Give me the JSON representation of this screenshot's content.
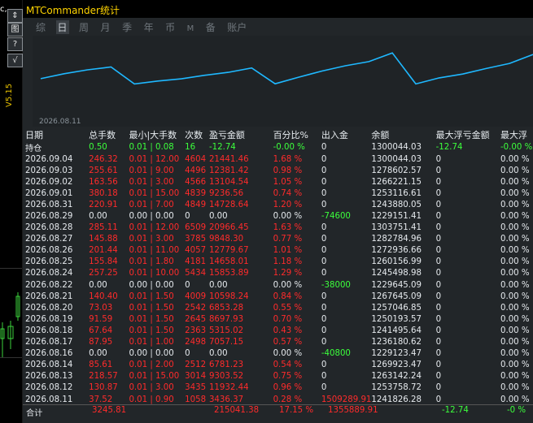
{
  "left_strip": {
    "top_text": "c,",
    "btn1": "⇕",
    "btn2": "图",
    "btn3": "?",
    "btn4": "√",
    "version": "V5.15"
  },
  "window": {
    "title": "MTCommander统计"
  },
  "tabs": [
    "综",
    "日",
    "周",
    "月",
    "季",
    "年",
    "币",
    "M",
    "备",
    "账户"
  ],
  "active_tab": "日",
  "chart": {
    "date_label": "2026.08.11",
    "line_color": "#1fb8ff",
    "chart_data": {
      "type": "line",
      "x_label": "",
      "y_label": "",
      "series": [
        {
          "values": [
            1241826,
            1245498,
            1250193,
            1257046,
            1260156,
            1272936,
            1282784,
            1303751,
            1303751,
            1300044
          ]
        }
      ]
    }
  },
  "headers": [
    "日期",
    "总手数",
    "最小|大手数",
    "次数",
    "盈亏金额",
    "百分比%",
    "出入金",
    "余额",
    "最大浮亏金额",
    "最大浮"
  ],
  "holding": [
    "持仓",
    "0.50",
    "0.01 | 0.08",
    "16",
    "-12.74",
    "-0.00 %",
    "0",
    "1300044.03",
    "-12.74",
    "-0.00 %"
  ],
  "rows": [
    [
      "2026.09.04",
      "246.32",
      "0.01 | 12.00",
      "4604",
      "21441.46",
      "1.68 %",
      "0",
      "1300044.03",
      "0",
      "0.00 %"
    ],
    [
      "2026.09.03",
      "255.61",
      "0.01 | 9.00",
      "4496",
      "12381.42",
      "0.98 %",
      "0",
      "1278602.57",
      "0",
      "0.00 %"
    ],
    [
      "2026.09.02",
      "163.56",
      "0.01 | 3.00",
      "4566",
      "13104.54",
      "1.05 %",
      "0",
      "1266221.15",
      "0",
      "0.00 %"
    ],
    [
      "2026.09.01",
      "380.18",
      "0.01 | 15.00",
      "4839",
      "9236.56",
      "0.74 %",
      "0",
      "1253116.61",
      "0",
      "0.00 %"
    ],
    [
      "2026.08.31",
      "220.91",
      "0.01 | 7.00",
      "4849",
      "14728.64",
      "1.20 %",
      "0",
      "1243880.05",
      "0",
      "0.00 %"
    ],
    [
      "2026.08.29",
      "0.00",
      "0.00 | 0.00",
      "0",
      "0.00",
      "0.00 %",
      "-74600",
      "1229151.41",
      "0",
      "0.00 %"
    ],
    [
      "2026.08.28",
      "285.11",
      "0.01 | 12.00",
      "6509",
      "20966.45",
      "1.63 %",
      "0",
      "1303751.41",
      "0",
      "0.00 %"
    ],
    [
      "2026.08.27",
      "145.88",
      "0.01 | 3.00",
      "3785",
      "9848.30",
      "0.77 %",
      "0",
      "1282784.96",
      "0",
      "0.00 %"
    ],
    [
      "2026.08.26",
      "201.44",
      "0.01 | 11.00",
      "4057",
      "12779.67",
      "1.01 %",
      "0",
      "1272936.66",
      "0",
      "0.00 %"
    ],
    [
      "2026.08.25",
      "155.84",
      "0.01 | 1.80",
      "4181",
      "14658.01",
      "1.18 %",
      "0",
      "1260156.99",
      "0",
      "0.00 %"
    ],
    [
      "2026.08.24",
      "257.25",
      "0.01 | 10.00",
      "5434",
      "15853.89",
      "1.29 %",
      "0",
      "1245498.98",
      "0",
      "0.00 %"
    ],
    [
      "2026.08.22",
      "0.00",
      "0.00 | 0.00",
      "0",
      "0.00",
      "0.00 %",
      "-38000",
      "1229645.09",
      "0",
      "0.00 %"
    ],
    [
      "2026.08.21",
      "140.40",
      "0.01 | 1.50",
      "4009",
      "10598.24",
      "0.84 %",
      "0",
      "1267645.09",
      "0",
      "0.00 %"
    ],
    [
      "2026.08.20",
      "73.03",
      "0.01 | 1.50",
      "2542",
      "6853.28",
      "0.55 %",
      "0",
      "1257046.85",
      "0",
      "0.00 %"
    ],
    [
      "2026.08.19",
      "91.59",
      "0.01 | 1.50",
      "2645",
      "8697.93",
      "0.70 %",
      "0",
      "1250193.57",
      "0",
      "0.00 %"
    ],
    [
      "2026.08.18",
      "67.64",
      "0.01 | 1.50",
      "2363",
      "5315.02",
      "0.43 %",
      "0",
      "1241495.64",
      "0",
      "0.00 %"
    ],
    [
      "2026.08.17",
      "87.95",
      "0.01 | 1.00",
      "2498",
      "7057.15",
      "0.57 %",
      "0",
      "1236180.62",
      "0",
      "0.00 %"
    ],
    [
      "2026.08.16",
      "0.00",
      "0.00 | 0.00",
      "0",
      "0.00",
      "0.00 %",
      "-40800",
      "1229123.47",
      "0",
      "0.00 %"
    ],
    [
      "2026.08.14",
      "85.61",
      "0.01 | 2.00",
      "2512",
      "6781.23",
      "0.54 %",
      "0",
      "1269923.47",
      "0",
      "0.00 %"
    ],
    [
      "2026.08.13",
      "218.57",
      "0.01 | 15.00",
      "3014",
      "9303.52",
      "0.75 %",
      "0",
      "1263142.24",
      "0",
      "0.00 %"
    ],
    [
      "2026.08.12",
      "130.87",
      "0.01 | 3.00",
      "3435",
      "11932.44",
      "0.96 %",
      "0",
      "1253758.72",
      "0",
      "0.00 %"
    ],
    [
      "2026.08.11",
      "37.52",
      "0.01 | 0.90",
      "1058",
      "3436.37",
      "0.28 %",
      "1509289.91",
      "1241826.28",
      "0",
      "0.00 %"
    ]
  ],
  "total": {
    "label": "合计",
    "lots": "3245.81",
    "profit": "215041.38",
    "pct": "17.15 %",
    "io": "1355889.91",
    "maxloss": "-12.74",
    "maxpct": "-0 %"
  }
}
